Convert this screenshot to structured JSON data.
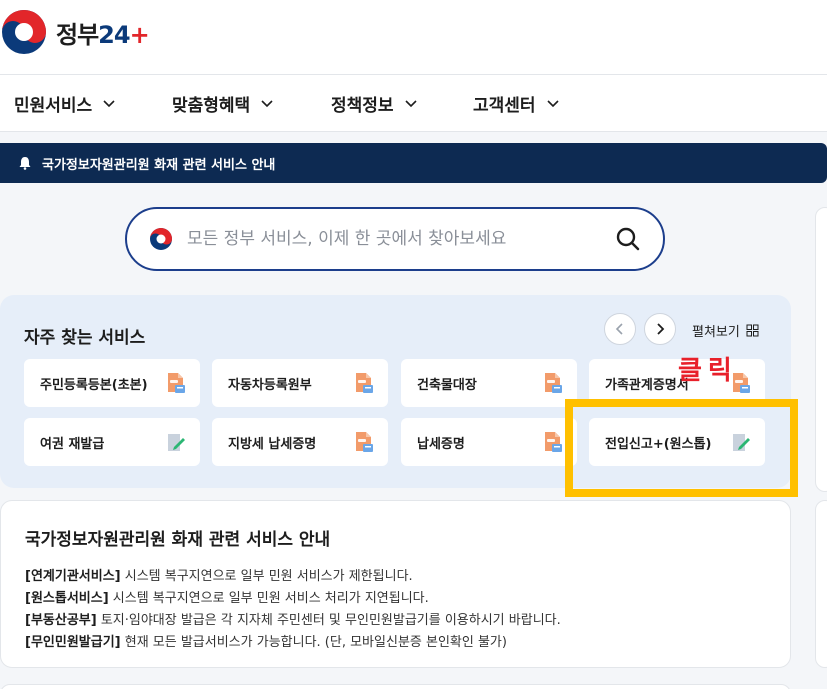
{
  "header": {
    "logo_text": "정부",
    "logo_num": "24",
    "logo_plus": "+"
  },
  "nav": {
    "items": [
      {
        "label": "민원서비스"
      },
      {
        "label": "맞춤형혜택"
      },
      {
        "label": "정책정보"
      },
      {
        "label": "고객센터"
      }
    ]
  },
  "notice_bar": {
    "text": "국가정보자원관리원 화재 관련 서비스 안내"
  },
  "search": {
    "placeholder": "모든 정부 서비스, 이제 한 곳에서 찾아보세요"
  },
  "frequent": {
    "title": "자주 찾는 서비스",
    "expand_label": "펼쳐보기",
    "services": [
      {
        "label": "주민등록등본(초본)",
        "icon": "pdf-doc-icon"
      },
      {
        "label": "자동차등록원부",
        "icon": "pdf-doc-icon"
      },
      {
        "label": "건축물대장",
        "icon": "pdf-doc-icon"
      },
      {
        "label": "가족관계증명서",
        "icon": "pdf-doc-icon"
      },
      {
        "label": "여권 재발급",
        "icon": "edit-doc-icon"
      },
      {
        "label": "지방세 납세증명",
        "icon": "pdf-doc-icon"
      },
      {
        "label": "납세증명",
        "icon": "pdf-doc-icon"
      },
      {
        "label": "전입신고+(원스톱)",
        "icon": "edit-doc-icon"
      }
    ]
  },
  "annotation": {
    "click_label": "클릭"
  },
  "info": {
    "title": "국가정보자원관리원 화재 관련 서비스 안내",
    "lines": [
      {
        "tag": "[연계기관서비스]",
        "text": " 시스템 복구지연으로 일부 민원 서비스가 제한됩니다."
      },
      {
        "tag": "[원스톱서비스]",
        "text": " 시스템 복구지연으로 일부 민원 서비스 처리가 지연됩니다."
      },
      {
        "tag": "[부동산공부]",
        "text": " 토지·임야대장 발급은 각 지자체 주민센터 및 무인민원발급기를 이용하시기 바랍니다."
      },
      {
        "tag": "[무인민원발급기]",
        "text": " 현재 모든 발급서비스가 가능합니다. (단, 모바일신분증 본인확인 불가)"
      }
    ]
  },
  "colors": {
    "brand_navy": "#0d2a52",
    "search_border": "#1c3e8c",
    "highlight": "#ffc000",
    "click_red": "#e8202a"
  }
}
